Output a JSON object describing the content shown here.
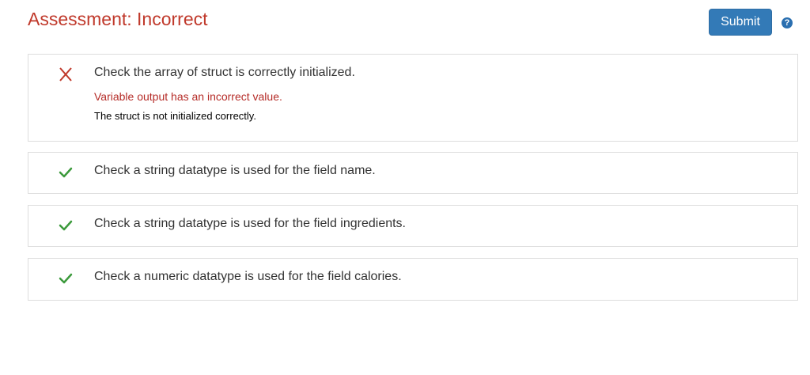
{
  "header": {
    "title": "Assessment: Incorrect",
    "submit_label": "Submit",
    "help_symbol": "?"
  },
  "colors": {
    "title": "#c0392b",
    "submit_bg": "#337ab7",
    "fail_icon": "#c0392b",
    "pass_icon": "#3c9a3c",
    "error_text": "#b52b27"
  },
  "checks": [
    {
      "status": "fail",
      "icon": "cross-icon",
      "label": "Check the array of struct is correctly initialized.",
      "error": "Variable output has an incorrect value.",
      "detail": "The struct is not initialized correctly."
    },
    {
      "status": "pass",
      "icon": "checkmark-icon",
      "label": "Check a string datatype is used for the field name."
    },
    {
      "status": "pass",
      "icon": "checkmark-icon",
      "label": "Check a string datatype is used for the field ingredients."
    },
    {
      "status": "pass",
      "icon": "checkmark-icon",
      "label": "Check a numeric datatype is used for the field calories."
    }
  ]
}
